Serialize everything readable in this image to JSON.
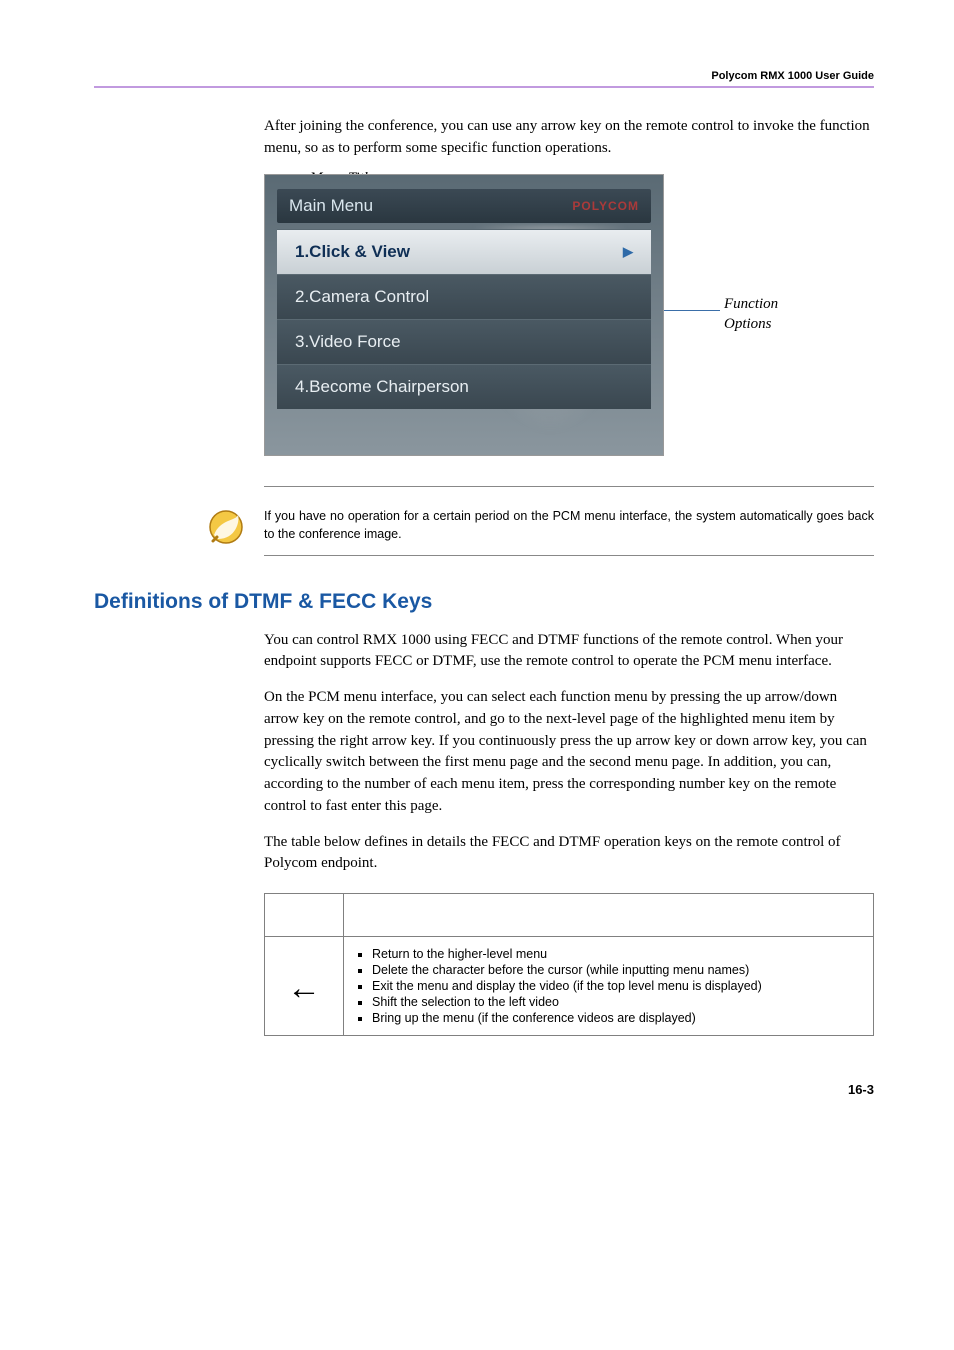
{
  "header": {
    "running": "Polycom RMX 1000 User Guide"
  },
  "intro": "After joining the conference, you can use any arrow key on the remote control to invoke the function menu, so as to perform some specific function operations.",
  "figure": {
    "menu_title_label": "Menu Title",
    "function_options_label_line1": "Function",
    "function_options_label_line2": "Options",
    "screenshot": {
      "title": "Main Menu",
      "logo": "POLYCOM",
      "items": [
        {
          "label": "1.Click & View",
          "selected": true,
          "submenu": true
        },
        {
          "label": "2.Camera Control",
          "selected": false,
          "submenu": false
        },
        {
          "label": "3.Video Force",
          "selected": false,
          "submenu": false
        },
        {
          "label": "4.Become Chairperson",
          "selected": false,
          "submenu": false
        }
      ]
    }
  },
  "note": "If you have no operation for a certain period on the PCM menu interface, the system automatically goes back to the conference image.",
  "section": {
    "title": "Definitions of DTMF & FECC Keys",
    "p1": "You can control RMX 1000 using FECC and DTMF functions of the remote control. When your endpoint supports FECC or DTMF, use the remote control to operate the PCM menu interface.",
    "p2": "On the PCM menu interface, you can select each function menu by pressing the up arrow/down arrow key on the remote control, and go to the next-level page of the highlighted menu item by pressing the right arrow key. If you continuously press the up arrow key or down arrow key, you can cyclically switch between the first menu page and the second menu page. In addition, you can, according to the number of each menu item, press the corresponding number key on the remote control to fast enter this page.",
    "p3": "The table below defines in details the FECC and DTMF operation keys on the remote control of Polycom endpoint."
  },
  "table": {
    "col1": "",
    "col2": "",
    "rows": [
      {
        "key": "←",
        "items": [
          "Return to the higher-level menu",
          "Delete the character before the cursor (while inputting menu names)",
          "Exit the menu and display the video (if the top level menu is displayed)",
          "Shift the selection to the left video",
          "Bring up the menu (if the conference videos are displayed)"
        ]
      }
    ]
  },
  "page_number": "16-3"
}
